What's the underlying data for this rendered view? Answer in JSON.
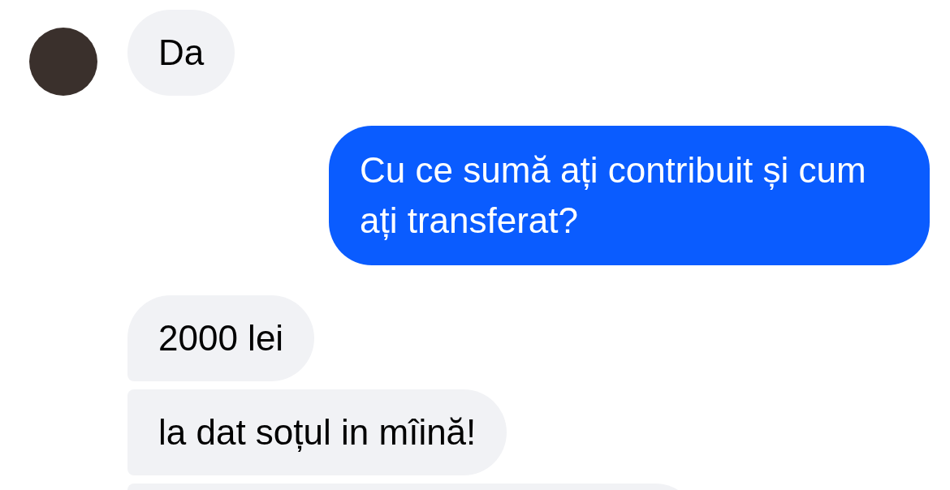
{
  "messages": [
    {
      "kind": "received",
      "text": "Da",
      "avatar": true
    },
    {
      "kind": "sent",
      "text": "Cu ce sumă ați contribuit și cum ați transferat?"
    },
    {
      "kind": "received",
      "text": "2000 lei",
      "avatar": false
    },
    {
      "kind": "received",
      "text": "la dat soțul in mîină!",
      "avatar": false
    },
    {
      "kind": "received"
    }
  ]
}
